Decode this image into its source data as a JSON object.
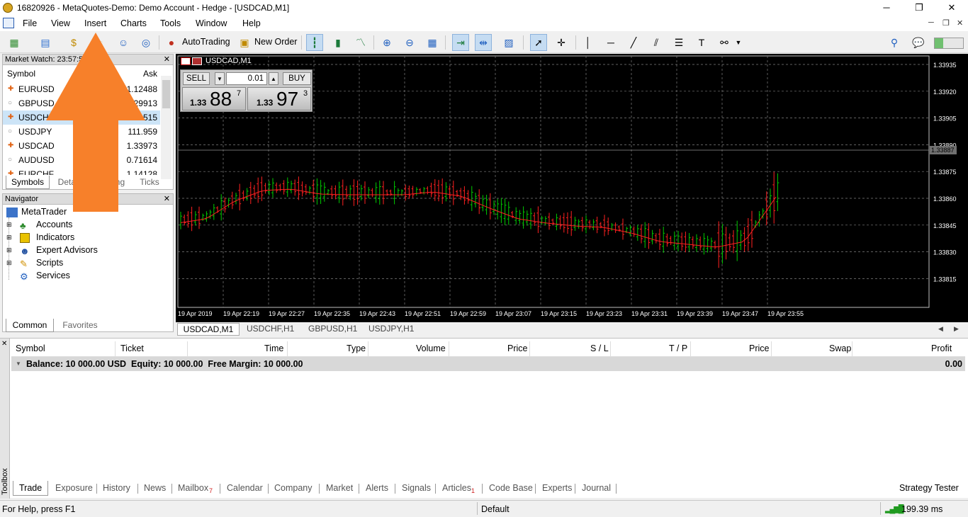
{
  "window": {
    "title": "16820926 - MetaQuotes-Demo: Demo Account - Hedge - [USDCAD,M1]",
    "min": "─",
    "max": "❐",
    "close": "✕"
  },
  "menu": [
    "File",
    "View",
    "Insert",
    "Charts",
    "Tools",
    "Window",
    "Help"
  ],
  "toolbar": {
    "autotrading": "AutoTrading",
    "new_order": "New Order"
  },
  "market_watch": {
    "title": "Market Watch: 23:57:5",
    "col_symbol": "Symbol",
    "col_ask": "Ask",
    "rows": [
      {
        "symbol": "EURUSD",
        "ask": "1.12488"
      },
      {
        "symbol": "GBPUSD",
        "ask": "1.29913"
      },
      {
        "symbol": "USDCHF",
        "ask": "1.01515"
      },
      {
        "symbol": "USDJPY",
        "ask": "111.959"
      },
      {
        "symbol": "USDCAD",
        "ask": "1.33973"
      },
      {
        "symbol": "AUDUSD",
        "ask": "0.71614"
      },
      {
        "symbol": "EURCHF",
        "ask": "1.14128"
      }
    ],
    "tabs": [
      "Symbols",
      "Details",
      "Trading",
      "Ticks"
    ]
  },
  "navigator": {
    "title": "Navigator",
    "root": "MetaTrader",
    "items": [
      "Accounts",
      "Indicators",
      "Expert Advisors",
      "Scripts",
      "Services"
    ],
    "tabs": [
      "Common",
      "Favorites"
    ]
  },
  "chart": {
    "label": "USDCAD,M1",
    "sell": "SELL",
    "buy": "BUY",
    "lot": "0.01",
    "bid_big": "1.33",
    "bid_main": "88",
    "bid_sup": "7",
    "ask_big": "1.33",
    "ask_main": "97",
    "ask_sup": "3",
    "current_price": "1.33887",
    "price_labels": [
      "1.33935",
      "1.33920",
      "1.33905",
      "1.33890",
      "1.33875",
      "1.33860",
      "1.33845",
      "1.33830",
      "1.33815"
    ],
    "time_labels": [
      "19 Apr 2019",
      "19 Apr 22:19",
      "19 Apr 22:27",
      "19 Apr 22:35",
      "19 Apr 22:43",
      "19 Apr 22:51",
      "19 Apr 22:59",
      "19 Apr 23:07",
      "19 Apr 23:15",
      "19 Apr 23:23",
      "19 Apr 23:31",
      "19 Apr 23:39",
      "19 Apr 23:47",
      "19 Apr 23:55"
    ],
    "colors": {
      "bull": "#00cc00",
      "bear": "#ff2020",
      "ma": "#ff2020",
      "grid": "#808080",
      "bg": "#000000"
    }
  },
  "chart_tabs": [
    "USDCAD,M1",
    "USDCHF,H1",
    "GBPUSD,H1",
    "USDJPY,H1"
  ],
  "toolbox": {
    "label": "Toolbox",
    "columns": [
      "Symbol",
      "Ticket",
      "Time",
      "Type",
      "Volume",
      "Price",
      "S / L",
      "T / P",
      "Price",
      "Swap",
      "Profit"
    ],
    "balance_text": "Balance: 10 000.00 USD  Equity: 10 000.00  Free Margin: 10 000.00",
    "profit": "0.00",
    "tabs": [
      "Trade",
      "Exposure",
      "History",
      "News",
      "Mailbox",
      "Calendar",
      "Company",
      "Market",
      "Alerts",
      "Signals",
      "Articles",
      "Code Base",
      "Experts",
      "Journal"
    ],
    "mailbox_badge": "7",
    "articles_badge": "1",
    "strategy_tester": "Strategy Tester"
  },
  "status": {
    "help": "For Help, press F1",
    "profile": "Default",
    "ping": "199.39 ms"
  }
}
